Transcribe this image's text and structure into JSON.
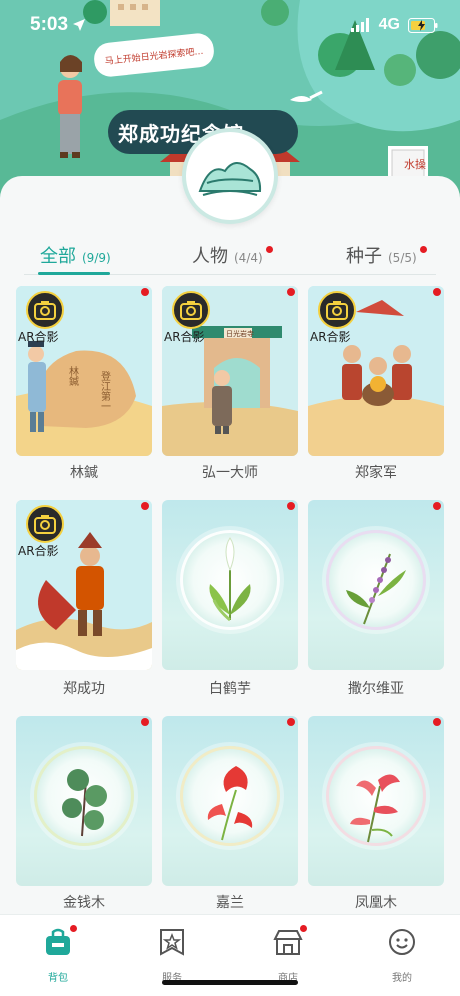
{
  "status_bar": {
    "time": "5:03",
    "network": "4G"
  },
  "banner": {
    "speech_text": "马上开始日光岩探索吧…",
    "hall_title": "郑成功纪念馆",
    "side_sign": "水操"
  },
  "tabs": [
    {
      "label": "全部",
      "count": "(9/9)",
      "active": true,
      "dot": false
    },
    {
      "label": "人物",
      "count": "(4/4)",
      "active": false,
      "dot": true
    },
    {
      "label": "种子",
      "count": "(5/5)",
      "active": false,
      "dot": true
    }
  ],
  "ar_label": "AR合影",
  "cards": [
    {
      "name": "林鍼",
      "ar": true,
      "kind": "person"
    },
    {
      "name": "弘一大师",
      "ar": true,
      "kind": "person"
    },
    {
      "name": "郑家军",
      "ar": true,
      "kind": "person"
    },
    {
      "name": "郑成功",
      "ar": true,
      "kind": "person"
    },
    {
      "name": "白鹤芋",
      "ar": false,
      "kind": "plant"
    },
    {
      "name": "撒尔维亚",
      "ar": false,
      "kind": "plant"
    },
    {
      "name": "金钱木",
      "ar": false,
      "kind": "plant"
    },
    {
      "name": "嘉兰",
      "ar": false,
      "kind": "plant"
    },
    {
      "name": "凤凰木",
      "ar": false,
      "kind": "plant"
    }
  ],
  "card_scene_texts": {
    "rock_text": "林鍼 登江第一",
    "gate_text": "日光岩寺"
  },
  "bottom_nav": [
    {
      "label": "背包",
      "icon": "backpack-icon",
      "active": true,
      "dot": true
    },
    {
      "label": "服务",
      "icon": "star-tag-icon",
      "active": false,
      "dot": false
    },
    {
      "label": "商店",
      "icon": "shop-icon",
      "active": false,
      "dot": true
    },
    {
      "label": "我的",
      "icon": "smile-face-icon",
      "active": false,
      "dot": false
    }
  ],
  "colors": {
    "accent": "#1fa89a",
    "dot": "#e51c23"
  }
}
